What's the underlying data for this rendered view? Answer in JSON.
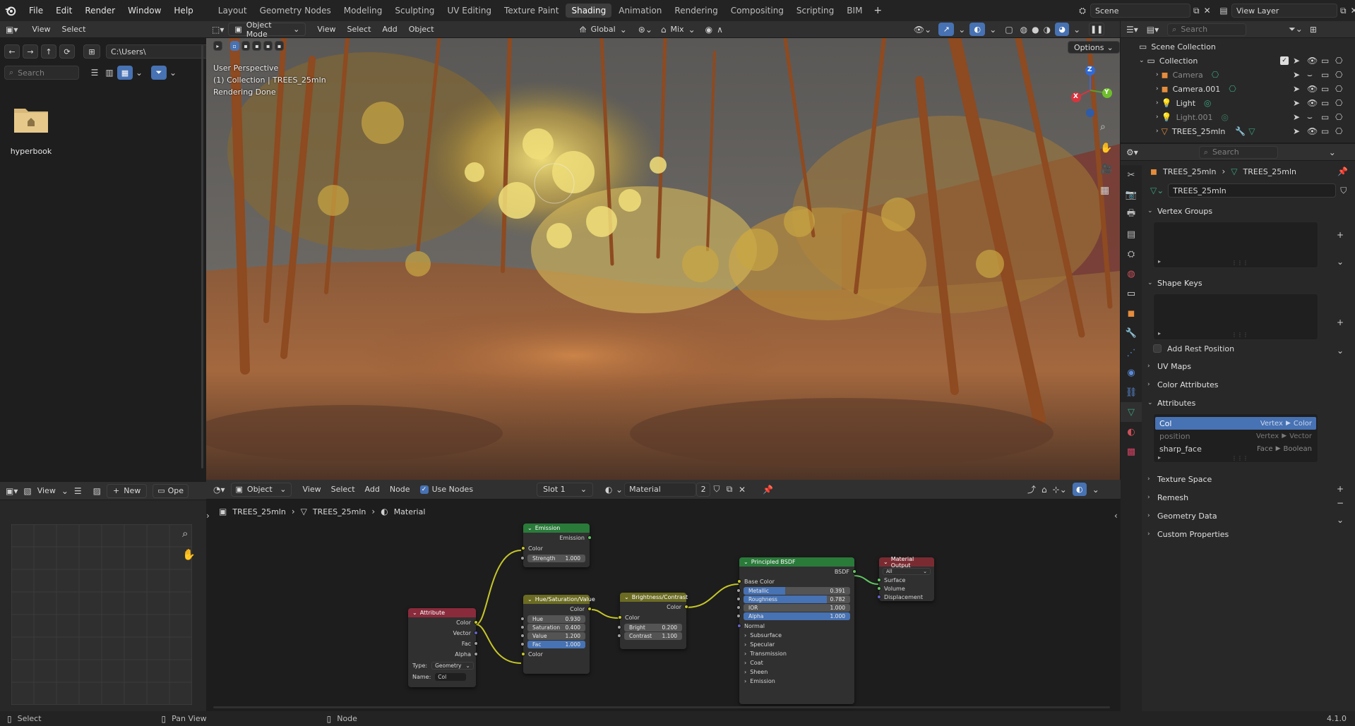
{
  "menus": [
    "File",
    "Edit",
    "Render",
    "Window",
    "Help"
  ],
  "workspaces": [
    "Layout",
    "Geometry Nodes",
    "Modeling",
    "Sculpting",
    "UV Editing",
    "Texture Paint",
    "Shading",
    "Animation",
    "Rendering",
    "Compositing",
    "Scripting",
    "BIM"
  ],
  "active_workspace": "Shading",
  "scene_name": "Scene",
  "view_layer": "View Layer",
  "file_browser": {
    "view": "View",
    "select": "Select",
    "path": "C:\\Users\\",
    "search_placeholder": "Search",
    "folder_name": "hyperbook"
  },
  "uv_header": {
    "view": "View",
    "new": "New",
    "open": "Ope"
  },
  "viewport": {
    "mode": "Object Mode",
    "view": "View",
    "select": "Select",
    "add": "Add",
    "object": "Object",
    "transform": "Global",
    "snap": "Mix",
    "options": "Options",
    "info1": "User Perspective",
    "info2": "(1) Collection | TREES_25mln",
    "info3": "Rendering Done",
    "gizmo_x": "X",
    "gizmo_y": "Y",
    "gizmo_z": "Z"
  },
  "node_header": {
    "object": "Object",
    "view": "View",
    "select": "Select",
    "add": "Add",
    "node": "Node",
    "use_nodes": "Use Nodes",
    "slot": "Slot 1",
    "material": "Material",
    "users": "2"
  },
  "breadcrumb": [
    "TREES_25mln",
    "TREES_25mln",
    "Material"
  ],
  "nodes": {
    "emission": {
      "title": "Emission",
      "out": "Emission",
      "color": "Color",
      "strength_label": "Strength",
      "strength": "1.000"
    },
    "attribute": {
      "title": "Attribute",
      "color": "Color",
      "vector": "Vector",
      "fac": "Fac",
      "alpha": "Alpha",
      "type_label": "Type:",
      "type": "Geometry",
      "name_label": "Name:",
      "name": "Col"
    },
    "hsv": {
      "title": "Hue/Saturation/Value",
      "out": "Color",
      "hue_label": "Hue",
      "hue": "0.930",
      "sat_label": "Saturation",
      "sat": "0.400",
      "val_label": "Value",
      "val": "1.200",
      "fac_label": "Fac",
      "fac": "1.000",
      "color": "Color"
    },
    "bc": {
      "title": "Brightness/Contrast",
      "out": "Color",
      "color": "Color",
      "bright_label": "Bright",
      "bright": "0.200",
      "contrast_label": "Contrast",
      "contrast": "1.100"
    },
    "bsdf": {
      "title": "Principled BSDF",
      "out": "BSDF",
      "base": "Base Color",
      "metallic_label": "Metallic",
      "metallic": "0.391",
      "rough_label": "Roughness",
      "rough": "0.782",
      "ior_label": "IOR",
      "ior": "1.000",
      "alpha_label": "Alpha",
      "alpha": "1.000",
      "normal": "Normal",
      "subsurface": "Subsurface",
      "specular": "Specular",
      "transmission": "Transmission",
      "coat": "Coat",
      "sheen": "Sheen",
      "emission": "Emission"
    },
    "output": {
      "title": "Material Output",
      "target": "All",
      "surface": "Surface",
      "volume": "Volume",
      "displacement": "Displacement"
    }
  },
  "outliner": {
    "search_placeholder": "Search",
    "scene_collection": "Scene Collection",
    "collection": "Collection",
    "items": [
      "Camera",
      "Camera.001",
      "Light",
      "Light.001",
      "TREES_25mln"
    ]
  },
  "properties": {
    "search_placeholder": "Search",
    "crumb_object": "TREES_25mln",
    "crumb_data": "TREES_25mln",
    "mesh_name": "TREES_25mln",
    "panels": {
      "vertex_groups": "Vertex Groups",
      "shape_keys": "Shape Keys",
      "add_rest": "Add Rest Position",
      "uv_maps": "UV Maps",
      "color_attributes": "Color Attributes",
      "attributes": "Attributes",
      "texture_space": "Texture Space",
      "remesh": "Remesh",
      "geometry_data": "Geometry Data",
      "custom_properties": "Custom Properties"
    },
    "attributes": [
      {
        "name": "Col",
        "domain": "Vertex",
        "type": "Color"
      },
      {
        "name": "position",
        "domain": "Vertex",
        "type": "Vector"
      },
      {
        "name": "sharp_face",
        "domain": "Face",
        "type": "Boolean"
      }
    ]
  },
  "status": {
    "select": "Select",
    "pan": "Pan View",
    "node": "Node",
    "version": "4.1.0"
  },
  "colors": {
    "accent": "#4772b3",
    "emission_header": "#2a7a3a",
    "attribute_header": "#8a2b3c",
    "converter_header": "#6b6b23",
    "bsdf_header": "#2a7a3a",
    "output_header": "#7a2b32"
  }
}
